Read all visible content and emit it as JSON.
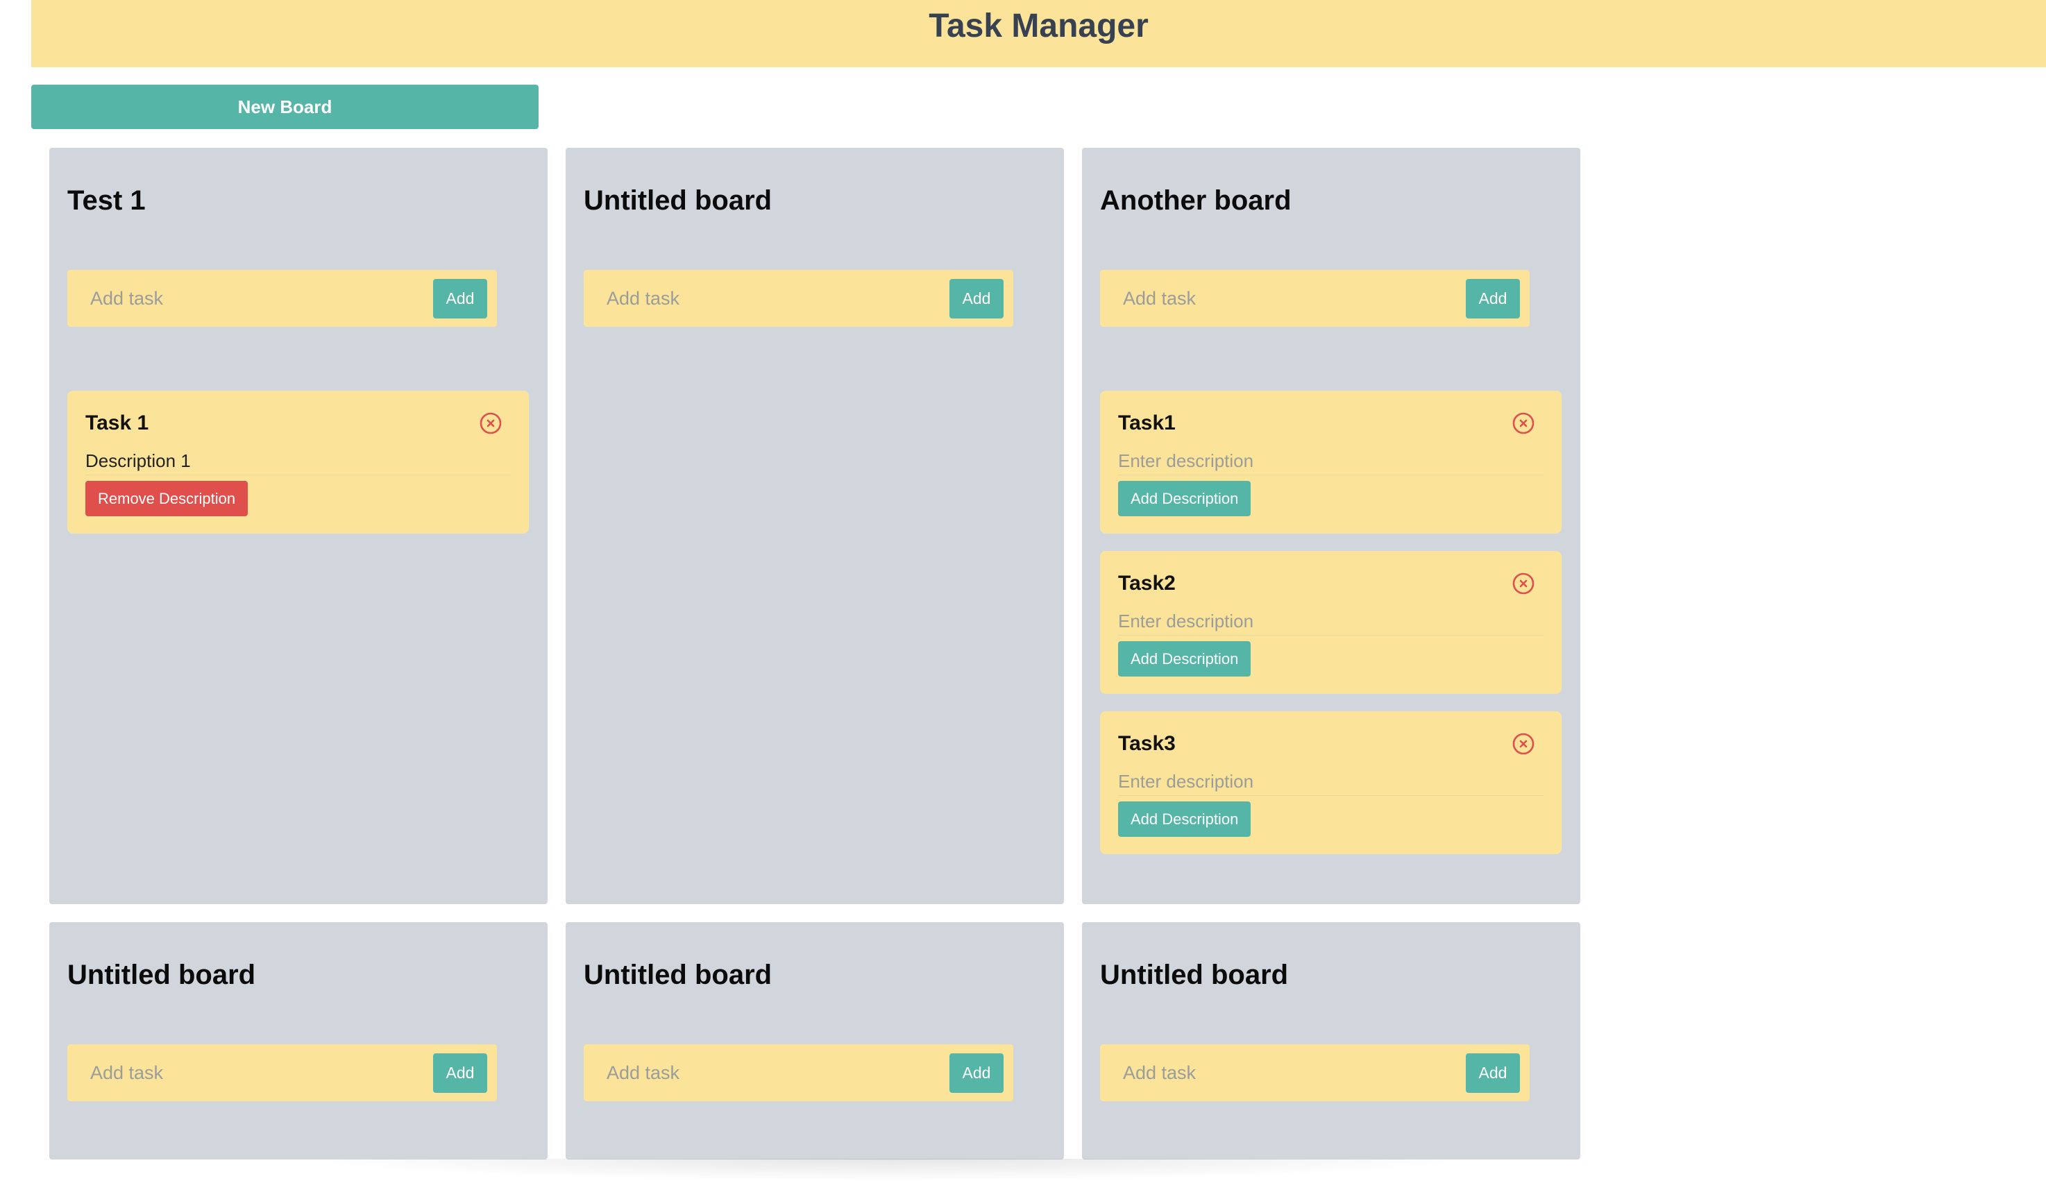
{
  "app": {
    "title": "Task Manager",
    "new_board_label": "New Board"
  },
  "icons": {
    "remove_task": "circle-x-icon"
  },
  "colors": {
    "header_bg": "#fbe499",
    "accent": "#55b5a6",
    "danger": "#df4f4c",
    "board_bg": "#d1d5dc"
  },
  "boards": [
    {
      "title": "Test 1",
      "add_placeholder": "Add task",
      "add_label": "Add",
      "tasks": [
        {
          "title": "Task 1",
          "description": "Description 1",
          "desc_placeholder": "Enter description",
          "button_label": "Remove Description"
        }
      ]
    },
    {
      "title": "Untitled board",
      "add_placeholder": "Add task",
      "add_label": "Add",
      "tasks": []
    },
    {
      "title": "Another board",
      "add_placeholder": "Add task",
      "add_label": "Add",
      "tasks": [
        {
          "title": "Task1",
          "description": "",
          "desc_placeholder": "Enter description",
          "button_label": "Add Description"
        },
        {
          "title": "Task2",
          "description": "",
          "desc_placeholder": "Enter description",
          "button_label": "Add Description"
        },
        {
          "title": "Task3",
          "description": "",
          "desc_placeholder": "Enter description",
          "button_label": "Add Description"
        }
      ]
    },
    {
      "title": "Untitled board",
      "add_placeholder": "Add task",
      "add_label": "Add",
      "tasks": []
    },
    {
      "title": "Untitled board",
      "add_placeholder": "Add task",
      "add_label": "Add",
      "tasks": []
    },
    {
      "title": "Untitled board",
      "add_placeholder": "Add task",
      "add_label": "Add",
      "tasks": []
    }
  ]
}
